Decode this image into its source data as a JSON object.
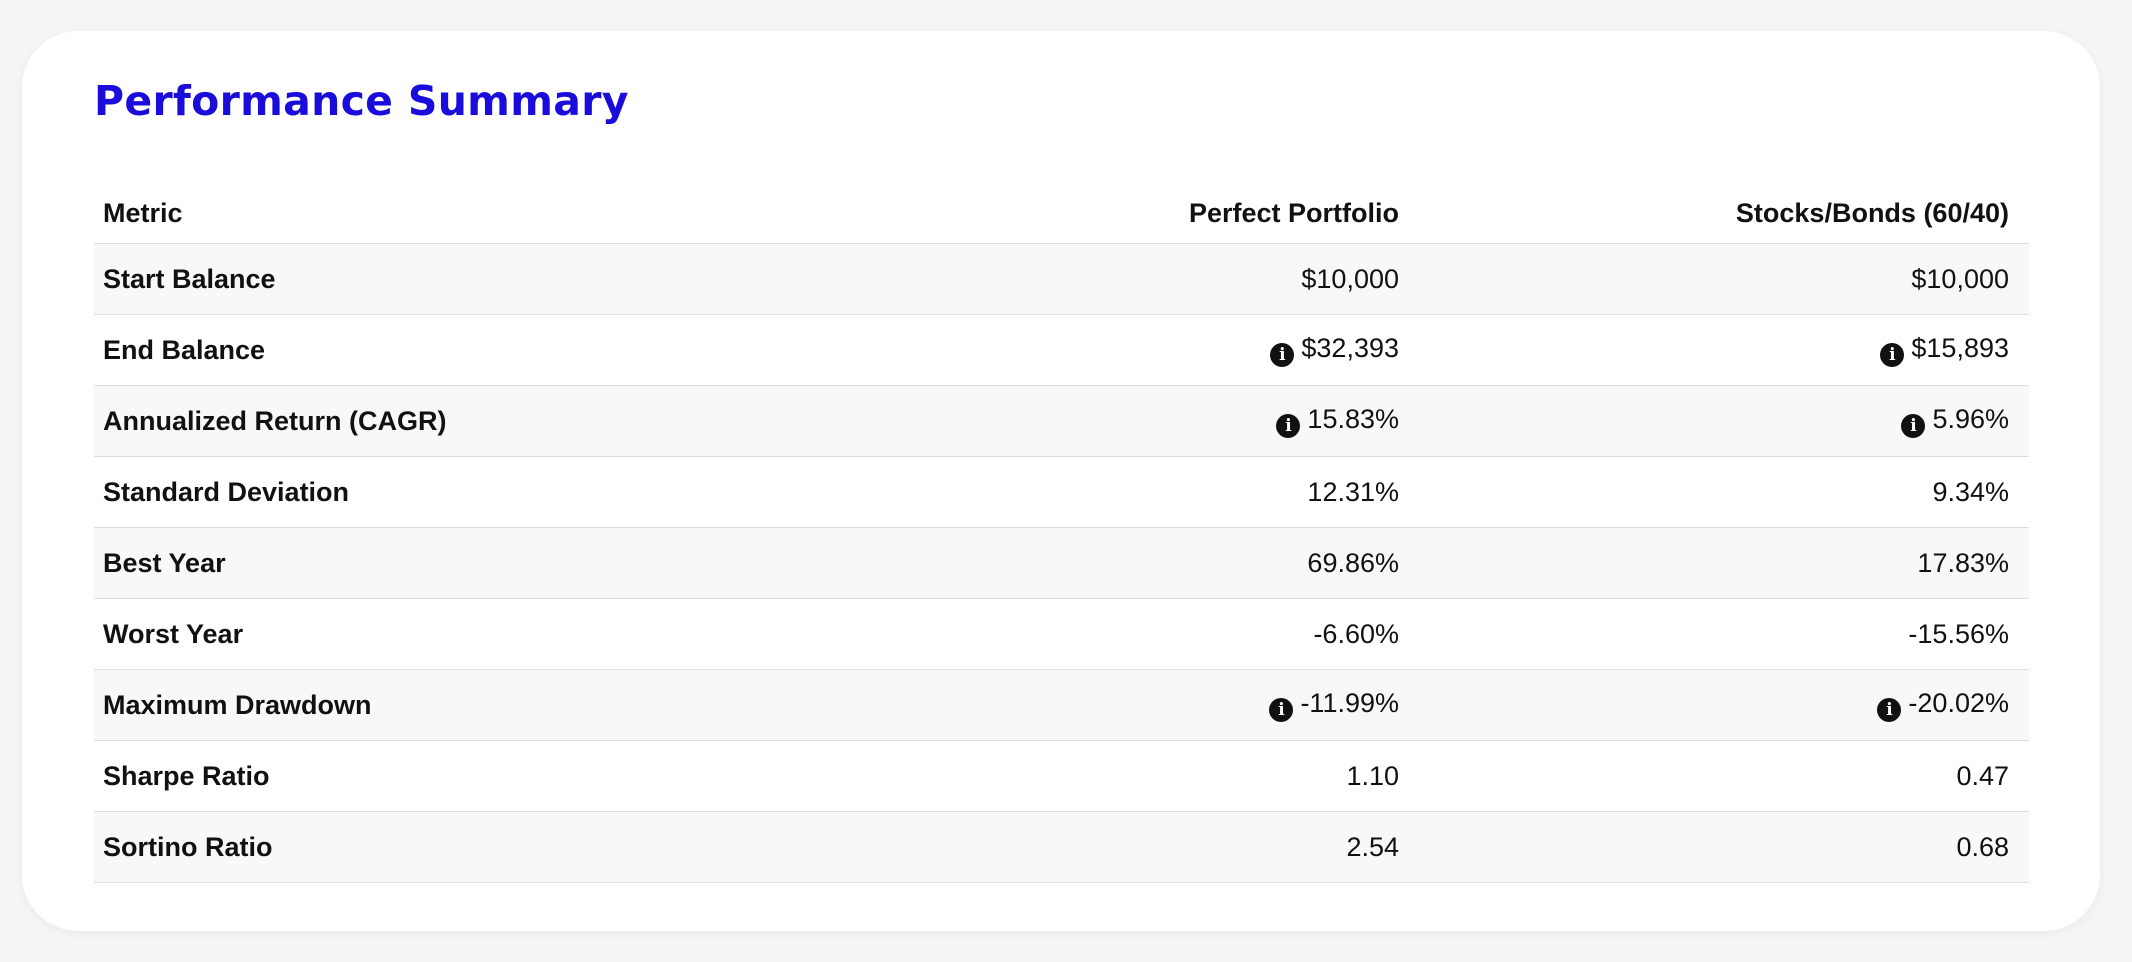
{
  "panel": {
    "title": "Performance Summary"
  },
  "table": {
    "headers": {
      "metric": "Metric",
      "col1": "Perfect Portfolio",
      "col2": "Stocks/Bonds (60/40)"
    },
    "info_icon": "info-circle-icon",
    "rows": [
      {
        "metric": "Start Balance",
        "v1": "$10,000",
        "v2": "$10,000",
        "info": false
      },
      {
        "metric": "End Balance",
        "v1": "$32,393",
        "v2": "$15,893",
        "info": true
      },
      {
        "metric": "Annualized Return (CAGR)",
        "v1": "15.83%",
        "v2": "5.96%",
        "info": true
      },
      {
        "metric": "Standard Deviation",
        "v1": "12.31%",
        "v2": "9.34%",
        "info": false
      },
      {
        "metric": "Best Year",
        "v1": "69.86%",
        "v2": "17.83%",
        "info": false
      },
      {
        "metric": "Worst Year",
        "v1": "-6.60%",
        "v2": "-15.56%",
        "info": false
      },
      {
        "metric": "Maximum Drawdown",
        "v1": "-11.99%",
        "v2": "-20.02%",
        "info": true
      },
      {
        "metric": "Sharpe Ratio",
        "v1": "1.10",
        "v2": "0.47",
        "info": false
      },
      {
        "metric": "Sortino Ratio",
        "v1": "2.54",
        "v2": "0.68",
        "info": false
      }
    ]
  },
  "colors": {
    "title": "#1a0ddb",
    "text": "#111111",
    "row_alt": "#f8f8f8",
    "border": "#dddddd"
  }
}
